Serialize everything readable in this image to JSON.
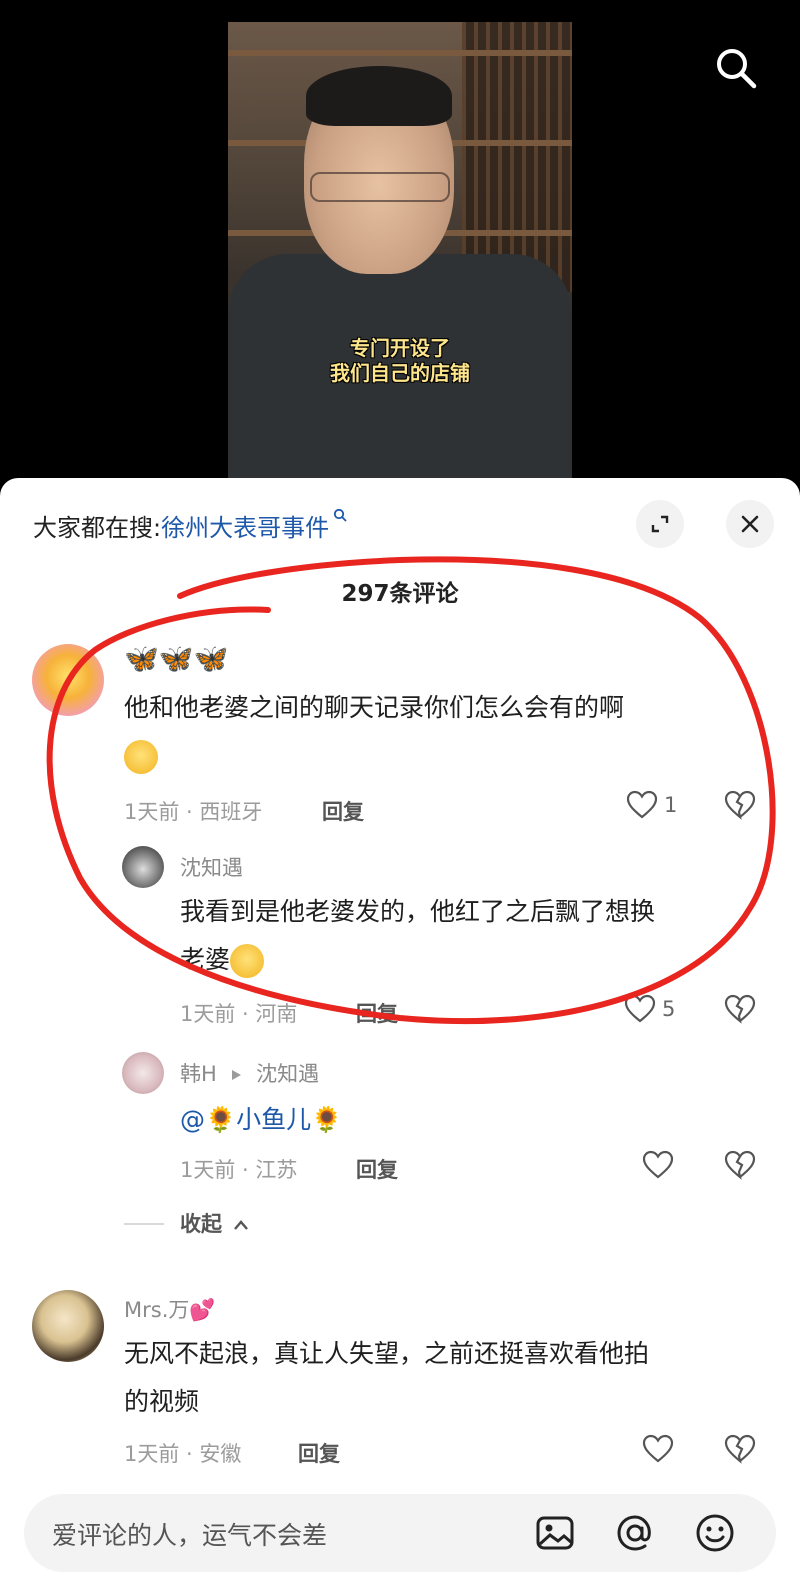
{
  "video": {
    "subtitle_line1": "专门开设了",
    "subtitle_line2": "我们自己的店铺"
  },
  "sheet": {
    "trending_prefix": "大家都在搜:",
    "trending_keyword": "徐州大表哥事件",
    "comment_count": "297条评论",
    "accent_color": "#1e58a9",
    "annotation_color": "#e8261f"
  },
  "comments": [
    {
      "username_emoji": "🦋🦋🦋",
      "text": "他和他老婆之间的聊天记录你们怎么会有的啊",
      "time_location": "1天前 · 西班牙",
      "reply_label": "回复",
      "likes": "1",
      "replies": [
        {
          "username": "沈知遇",
          "text_line1": "我看到是他老婆发的，他红了之后飘了想换",
          "text_line2": "老婆",
          "time_location": "1天前 · 河南",
          "reply_label": "回复",
          "likes": "5"
        },
        {
          "username": "韩H",
          "reply_to": "沈知遇",
          "mention_text": "@🌻小鱼儿🌻",
          "time_location": "1天前 · 江苏",
          "reply_label": "回复",
          "likes": ""
        }
      ],
      "collapse_label": "收起"
    },
    {
      "username": "Mrs.万💕",
      "text_line1": "无风不起浪，真让人失望，之前还挺喜欢看他拍",
      "text_line2": "的视频",
      "time_location": "1天前 · 安徽",
      "reply_label": "回复",
      "likes": ""
    }
  ],
  "input": {
    "placeholder": "爱评论的人，运气不会差"
  },
  "icons": [
    "search-icon",
    "expand-icon",
    "close-icon",
    "heart-icon",
    "broken-heart-icon",
    "image-icon",
    "at-icon",
    "emoji-icon"
  ]
}
